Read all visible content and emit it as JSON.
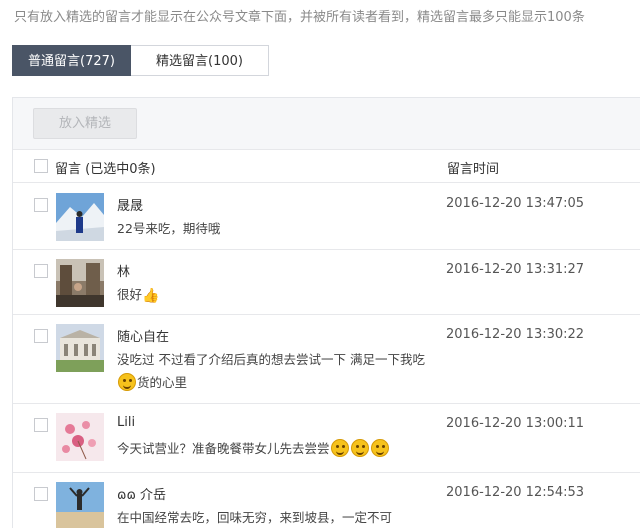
{
  "notice": "只有放入精选的留言才能显示在公众号文章下面，并被所有读者看到，精选留言最多只能显示100条",
  "tabs": [
    {
      "label": "普通留言(727)",
      "active": true
    },
    {
      "label": "精选留言(100)",
      "active": false
    }
  ],
  "toolbar": {
    "feature_label": "放入精选"
  },
  "table_header": {
    "message": "留言 (已选中0条)",
    "time": "留言时间"
  },
  "comments": [
    {
      "nickname": "晟晟",
      "message": "22号来吃，期待哦",
      "time": "2016-12-20 13:47:05",
      "avatar": "snow-mountain-photo"
    },
    {
      "nickname": "林",
      "message": "很好",
      "message_icon": "thumbs-up-icon",
      "time": "2016-12-20 13:31:27",
      "avatar": "street-photo"
    },
    {
      "nickname": "随心自在",
      "message_a": "没吃过 不过看了介绍后真的想去尝试一下 满足一下我吃",
      "message_icon": "smile-emoji-icon",
      "message_b": "货的心里",
      "time": "2016-12-20 13:30:22",
      "avatar": "building-photo"
    },
    {
      "nickname": "Lili",
      "message": "今天试营业？准备晚餐带女儿先去尝尝",
      "message_icons": [
        "smile-emoji-icon",
        "smile-emoji-icon",
        "smile-emoji-icon"
      ],
      "time": "2016-12-20 13:00:11",
      "avatar": "pink-flowers-photo"
    },
    {
      "nickname": "ɷɷ 介岳",
      "message": "在中国经常去吃，回味无穷，来到坡县，一定不可",
      "time": "2016-12-20 12:54:53",
      "avatar": "beach-jump-photo"
    }
  ]
}
